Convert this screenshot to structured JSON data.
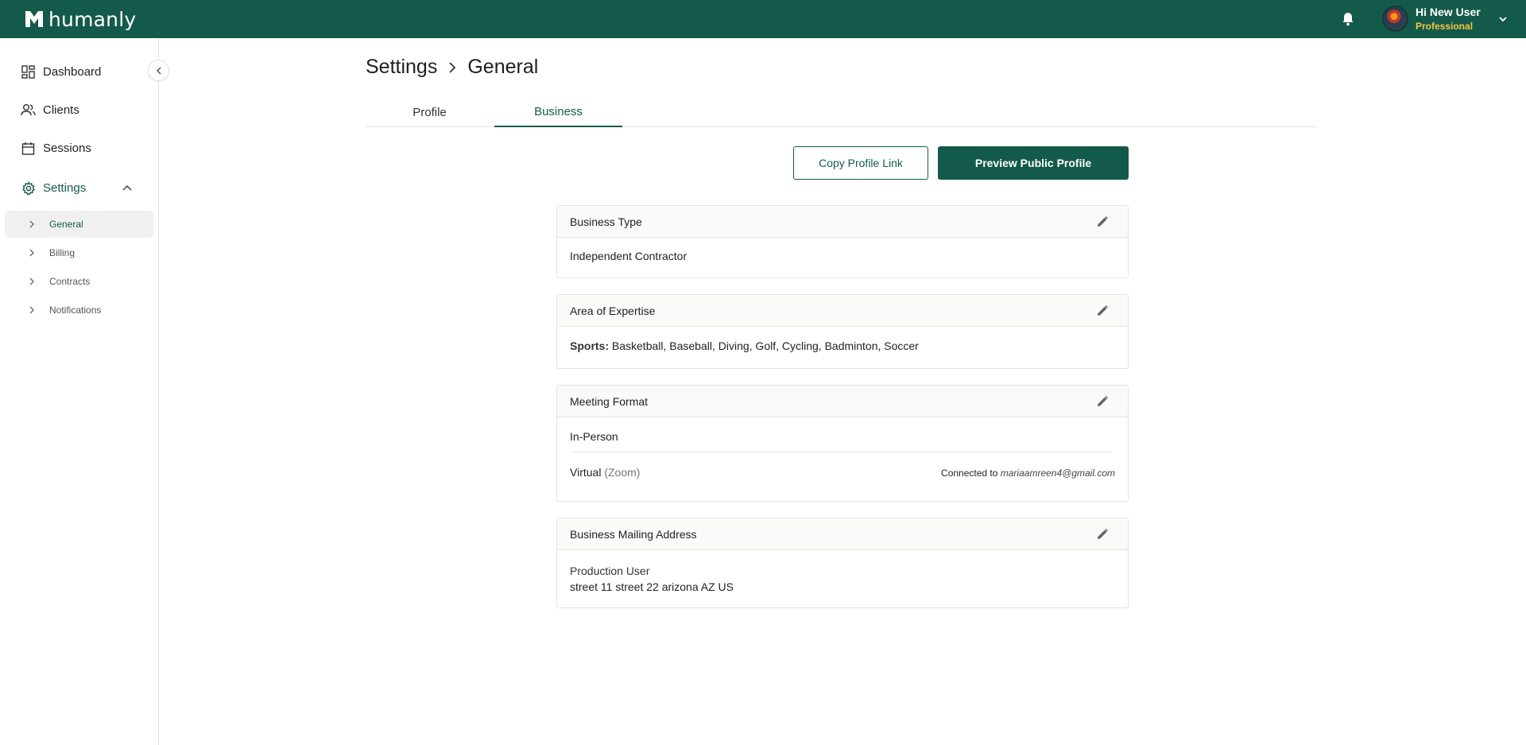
{
  "brand": {
    "name": "humanly"
  },
  "user": {
    "greeting": "Hi New User",
    "role": "Professional"
  },
  "sidebar": {
    "items": [
      {
        "label": "Dashboard"
      },
      {
        "label": "Clients"
      },
      {
        "label": "Sessions"
      },
      {
        "label": "Settings"
      }
    ],
    "settings_sub": [
      {
        "label": "General"
      },
      {
        "label": "Billing"
      },
      {
        "label": "Contracts"
      },
      {
        "label": "Notifications"
      }
    ]
  },
  "breadcrumb": {
    "parent": "Settings",
    "current": "General"
  },
  "tabs": [
    {
      "label": "Profile"
    },
    {
      "label": "Business"
    }
  ],
  "actions": {
    "copy_link": "Copy Profile Link",
    "preview": "Preview Public Profile"
  },
  "cards": {
    "business_type": {
      "title": "Business Type",
      "value": "Independent Contractor"
    },
    "expertise": {
      "title": "Area of Expertise",
      "category": "Sports:",
      "values": "Basketball, Baseball, Diving, Golf, Cycling, Badminton, Soccer"
    },
    "meeting_format": {
      "title": "Meeting Format",
      "in_person": "In-Person",
      "virtual": "Virtual",
      "virtual_provider": "(Zoom)",
      "connected_prefix": "Connected to",
      "connected_email": "mariaamreen4@gmail.com"
    },
    "mailing_address": {
      "title": "Business Mailing Address",
      "name": "Production User",
      "address": "street 11 street 22 arizona AZ US"
    }
  },
  "colors": {
    "brand": "#145a4a",
    "role": "#f5c842"
  }
}
